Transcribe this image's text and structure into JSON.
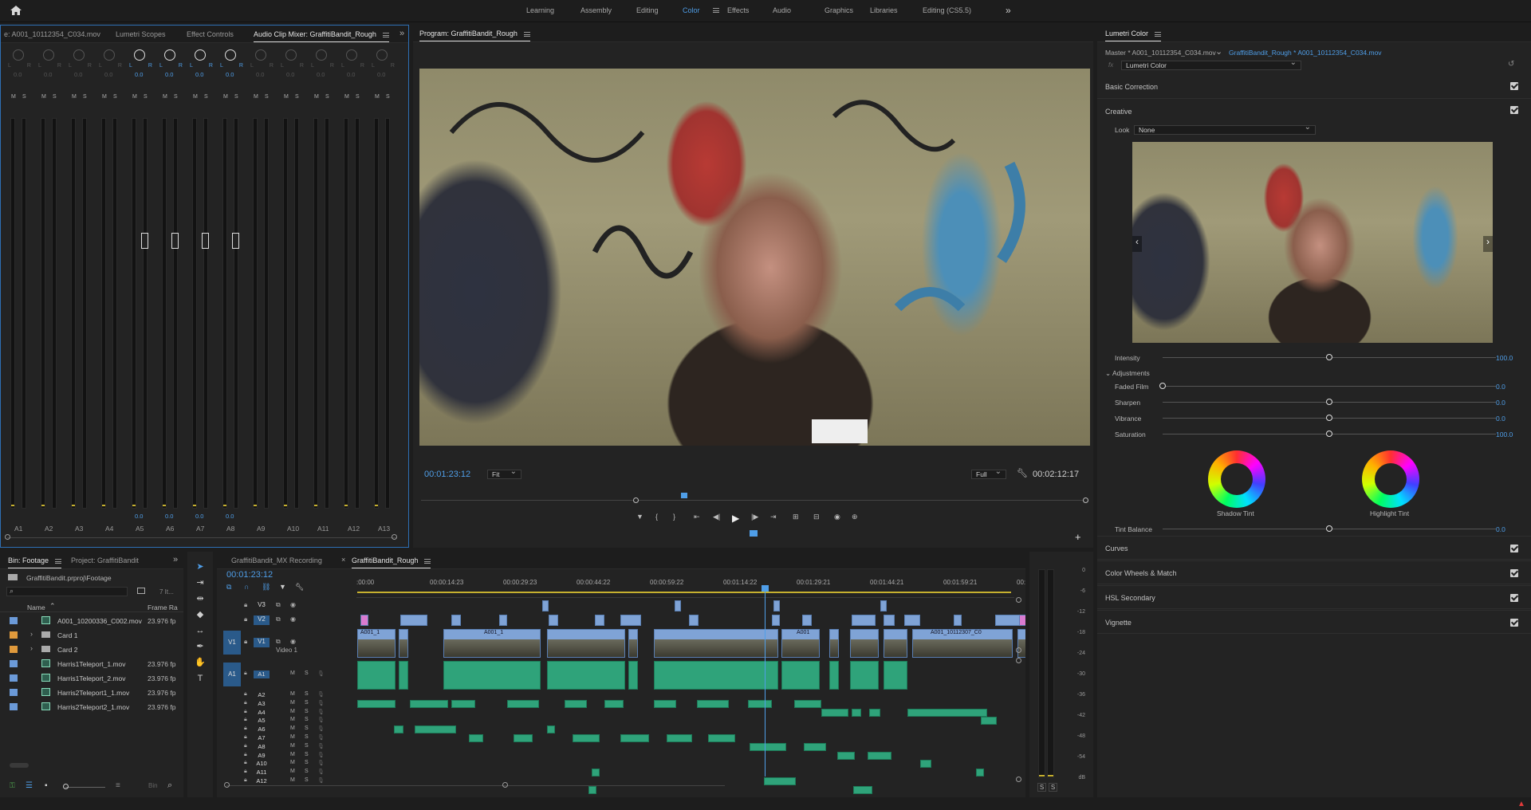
{
  "workspaces": {
    "items": [
      "Learning",
      "Assembly",
      "Editing",
      "Color",
      "Effects",
      "Audio",
      "Graphics",
      "Libraries",
      "Editing (CS5.5)"
    ],
    "active": "Color"
  },
  "source_panel": {
    "tabs": [
      "e: A001_10112354_C034.mov",
      "Lumetri Scopes",
      "Effect Controls",
      "Audio Clip Mixer: GraffitiBandit_Rough"
    ],
    "active_tab": 3,
    "channels": [
      "A1",
      "A2",
      "A3",
      "A4",
      "A5",
      "A6",
      "A7",
      "A8",
      "A9",
      "A10",
      "A11",
      "A12",
      "A13"
    ],
    "pan_value": "0.0",
    "fader_value": "0.0",
    "lr": "L",
    "lr_r": "R",
    "mute": "M",
    "solo": "S"
  },
  "program": {
    "title": "Program: GraffitiBandit_Rough",
    "timecode": "00:01:23:12",
    "fit": "Fit",
    "quality": "Full",
    "duration": "00:02:12:17"
  },
  "lumetri": {
    "title": "Lumetri Color",
    "master_clip": "Master * A001_10112354_C034.mov",
    "sequence_clip": "GraffitiBandit_Rough * A001_10112354_C034.mov",
    "fx_name": "Lumetri Color",
    "basic_correction": "Basic Correction",
    "creative": "Creative",
    "look_label": "Look",
    "look_value": "None",
    "intensity_label": "Intensity",
    "intensity_value": "100.0",
    "adjustments": "Adjustments",
    "sliders": [
      {
        "label": "Faded Film",
        "value": "0.0",
        "fraction": 0.0
      },
      {
        "label": "Sharpen",
        "value": "0.0",
        "fraction": 0.5
      },
      {
        "label": "Vibrance",
        "value": "0.0",
        "fraction": 0.5
      },
      {
        "label": "Saturation",
        "value": "100.0",
        "fraction": 0.5
      }
    ],
    "shadow_tint": "Shadow Tint",
    "highlight_tint": "Highlight Tint",
    "tint_balance_label": "Tint Balance",
    "tint_balance_value": "0.0",
    "sections": [
      "Curves",
      "Color Wheels & Match",
      "HSL Secondary",
      "Vignette"
    ]
  },
  "project": {
    "tabs": [
      "Bin: Footage",
      "Project: GraffitiBandit"
    ],
    "path": "GraffitiBandit.prproj\\Footage",
    "item_count": "7 It...",
    "col_name": "Name",
    "col_frame_rate": "Frame Ra",
    "items": [
      {
        "name": "A001_10200336_C002.mov",
        "rate": "23.976 fp",
        "color": "#6b9ad8",
        "type": "clip"
      },
      {
        "name": "Card 1",
        "rate": "",
        "color": "#e09a3c",
        "type": "folder"
      },
      {
        "name": "Card 2",
        "rate": "",
        "color": "#e09a3c",
        "type": "folder"
      },
      {
        "name": "Harris1Teleport_1.mov",
        "rate": "23.976 fp",
        "color": "#6b9ad8",
        "type": "clip"
      },
      {
        "name": "Harris1Teleport_2.mov",
        "rate": "23.976 fp",
        "color": "#6b9ad8",
        "type": "clip"
      },
      {
        "name": "Harris2Teleport1_1.mov",
        "rate": "23.976 fp",
        "color": "#6b9ad8",
        "type": "clip"
      },
      {
        "name": "Harris2Teleport2_1.mov",
        "rate": "23.976 fp",
        "color": "#6b9ad8",
        "type": "clip"
      }
    ]
  },
  "timeline": {
    "tabs": [
      "GraffitiBandit_MX Recording",
      "GraffitiBandit_Rough"
    ],
    "active_tab": 1,
    "timecode": "00:01:23:12",
    "ruler": [
      ":00:00",
      "00:00:14:23",
      "00:00:29:23",
      "00:00:44:22",
      "00:00:59:22",
      "00:01:14:22",
      "00:01:29:21",
      "00:01:44:21",
      "00:01:59:21",
      "00:02"
    ],
    "video_tracks": [
      "V3",
      "V2",
      "V1"
    ],
    "video1_name": "Video 1",
    "audio_tracks": [
      "A1",
      "A2",
      "A3",
      "A4",
      "A5",
      "A6",
      "A7",
      "A8",
      "A9",
      "A10",
      "A11",
      "A12"
    ],
    "clip_label_1": "A001_1",
    "clip_label_2": "A001_1",
    "clip_label_3": "A001",
    "clip_label_4": "A001_10112307_C0"
  },
  "meter": {
    "scale": [
      "0",
      "-6",
      "-12",
      "-18",
      "-24",
      "-30",
      "-36",
      "-42",
      "-48",
      "-54",
      "dB"
    ],
    "solo_left": "S",
    "solo_right": "S"
  }
}
